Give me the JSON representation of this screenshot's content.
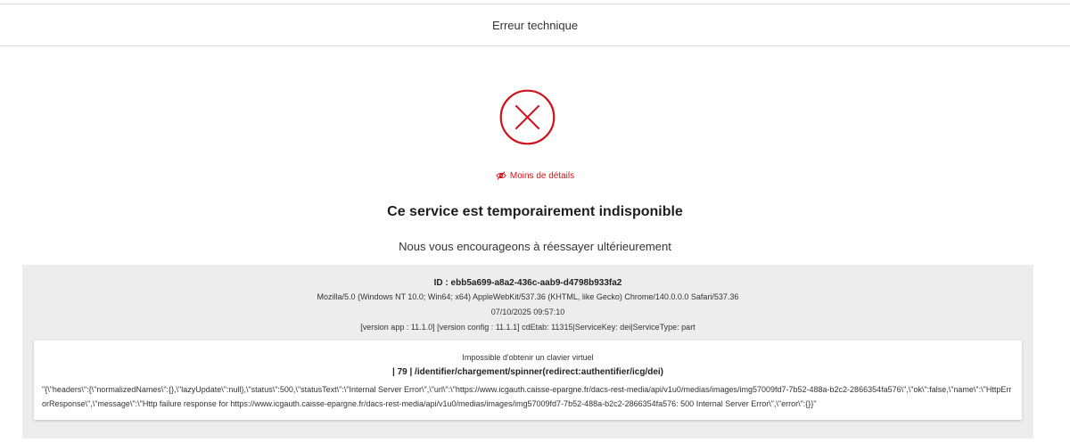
{
  "header": {
    "title": "Erreur technique"
  },
  "colors": {
    "accent": "#d0111b",
    "panel": "#ededed"
  },
  "error_icon": {
    "name": "error-circle-x-icon"
  },
  "details_toggle": {
    "label": "Moins de détails",
    "icon": "eye-slash-icon"
  },
  "message": {
    "title": "Ce service est temporairement indisponible",
    "subtitle": "Nous vous encourageons à réessayer ultérieurement"
  },
  "details": {
    "id": "ID : ebb5a699-a8a2-436c-aab9-d4798b933fa2",
    "user_agent": "Mozilla/5.0 (Windows NT 10.0; Win64; x64) AppleWebKit/537.36 (KHTML, like Gecko) Chrome/140.0.0.0 Safari/537.36",
    "datetime": "07/10/2025 09:57:10",
    "version": "[version app : 11.1.0] [version config : 11.1.1] cdEtab: 11315|ServiceKey: dei|ServiceType: part",
    "error": {
      "message": "Impossible d'obtenir un clavier virtuel",
      "route": "| 79 | /identifier/chargement/spinner(redirect:authentifier/icg/dei)",
      "payload": "\"{\\\"headers\\\":{\\\"normalizedNames\\\":{},\\\"lazyUpdate\\\":null},\\\"status\\\":500,\\\"statusText\\\":\\\"Internal Server Error\\\",\\\"url\\\":\\\"https://www.icgauth.caisse-epargne.fr/dacs-rest-media/api/v1u0/medias/images/img57009fd7-7b52-488a-b2c2-2866354fa576\\\",\\\"ok\\\":false,\\\"name\\\":\\\"HttpErrorResponse\\\",\\\"message\\\":\\\"Http failure response for https://www.icgauth.caisse-epargne.fr/dacs-rest-media/api/v1u0/medias/images/img57009fd7-7b52-488a-b2c2-2866354fa576: 500 Internal Server Error\\\",\\\"error\\\":{}}\""
    }
  }
}
